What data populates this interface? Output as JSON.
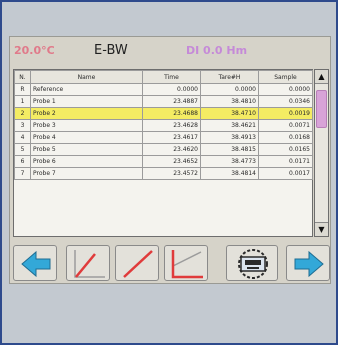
{
  "status": {
    "temperature": "20.0°C",
    "mode": "E-BW",
    "info": "DI 0.0 Hm"
  },
  "table": {
    "headers": [
      "N.",
      "Name",
      "Time",
      "Tare#H",
      "Sample"
    ],
    "rows": [
      {
        "n": "R",
        "name": "Reference",
        "time": "0.0000",
        "tare": "0.0000",
        "sample": "0.0000"
      },
      {
        "n": "1",
        "name": "Probe 1",
        "time": "23.4887",
        "tare": "38.4810",
        "sample": "0.0346"
      },
      {
        "n": "2",
        "name": "Probe 2",
        "time": "23.4688",
        "tare": "38.4710",
        "sample": "0.0019"
      },
      {
        "n": "3",
        "name": "Probe 3",
        "time": "23.4628",
        "tare": "38.4621",
        "sample": "0.0071"
      },
      {
        "n": "4",
        "name": "Probe 4",
        "time": "23.4617",
        "tare": "38.4913",
        "sample": "0.0168"
      },
      {
        "n": "5",
        "name": "Probe 5",
        "time": "23.4620",
        "tare": "38.4815",
        "sample": "0.0165"
      },
      {
        "n": "6",
        "name": "Probe 6",
        "time": "23.4652",
        "tare": "38.4773",
        "sample": "0.0171"
      },
      {
        "n": "7",
        "name": "Probe 7",
        "time": "23.4572",
        "tare": "38.4814",
        "sample": "0.0017"
      }
    ],
    "selected_row": 2
  },
  "scrollbar": {
    "up_icon": "chevron-up-icon",
    "down_icon": "chevron-down-icon",
    "up_glyph": "▲",
    "down_glyph": "▼"
  },
  "toolbar": {
    "icons": [
      "arrow-left-icon",
      "slope-up-line-icon",
      "diagonal-line-icon",
      "corner-line-icon",
      "device-gear-icon",
      "arrow-right-icon"
    ]
  },
  "colors": {
    "selected_row": "#f4ec63",
    "arrow_blue": "#33a8d8",
    "line_red": "#e03b3b",
    "status_pink": "#e07a8a",
    "status_violet": "#c58ad8",
    "scroll_thumb": "#d8a3d8"
  }
}
